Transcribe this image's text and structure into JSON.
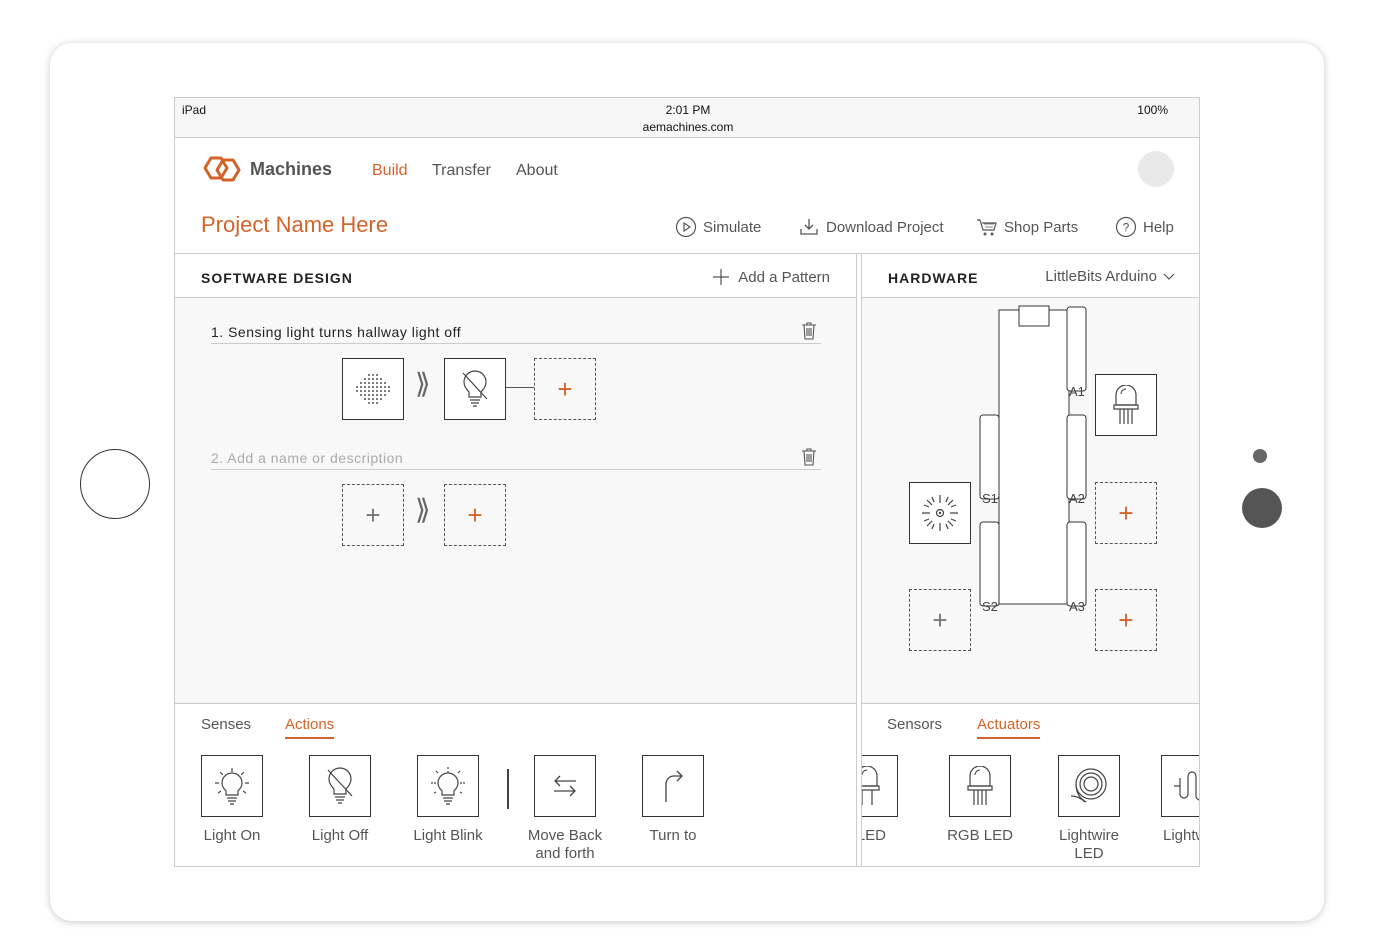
{
  "status_bar": {
    "device": "iPad",
    "time": "2:01 PM",
    "url": "aemachines.com",
    "battery": "100%"
  },
  "header": {
    "brand": "Machines",
    "nav": [
      {
        "label": "Build",
        "active": true
      },
      {
        "label": "Transfer"
      },
      {
        "label": "About"
      }
    ],
    "project_name": "Project Name Here",
    "toolbar": {
      "simulate": "Simulate",
      "download": "Download Project",
      "shop": "Shop Parts",
      "help": "Help"
    }
  },
  "software": {
    "title": "SOFTWARE DESIGN",
    "add_pattern": "Add a Pattern",
    "patterns": [
      {
        "name": "1. Sensing light turns hallway light off"
      },
      {
        "placeholder": "2. Add a name or description"
      }
    ],
    "tabs": [
      {
        "label": "Senses"
      },
      {
        "label": "Actions",
        "active": true
      }
    ],
    "items": [
      {
        "label": "Light On",
        "icon": "light-on-icon"
      },
      {
        "label": "Light Off",
        "icon": "light-off-icon"
      },
      {
        "label": "Light Blink",
        "icon": "light-blink-icon"
      },
      {
        "label": "Move Back and forth",
        "icon": "move-back-forth-icon"
      },
      {
        "label": "Turn to",
        "icon": "turn-icon"
      }
    ]
  },
  "hardware": {
    "title": "HARDWARE",
    "board": "LittleBits Arduino",
    "ports": {
      "a1": "A1",
      "a2": "A2",
      "a3": "A3",
      "s1": "S1",
      "s2": "S2"
    },
    "tabs": [
      {
        "label": "Sensors"
      },
      {
        "label": "Actuators",
        "active": true
      }
    ],
    "items": [
      {
        "label": "LED",
        "icon": "led-icon"
      },
      {
        "label": "RGB LED",
        "icon": "rgb-led-icon"
      },
      {
        "label": "Lightwire LED",
        "icon": "lightwire-icon"
      },
      {
        "label": "Lightwir",
        "icon": "lightwire-2-icon"
      }
    ]
  },
  "colors": {
    "accent": "#d4632a",
    "panel_bg": "#f8f8f8",
    "border": "#cccccc"
  }
}
